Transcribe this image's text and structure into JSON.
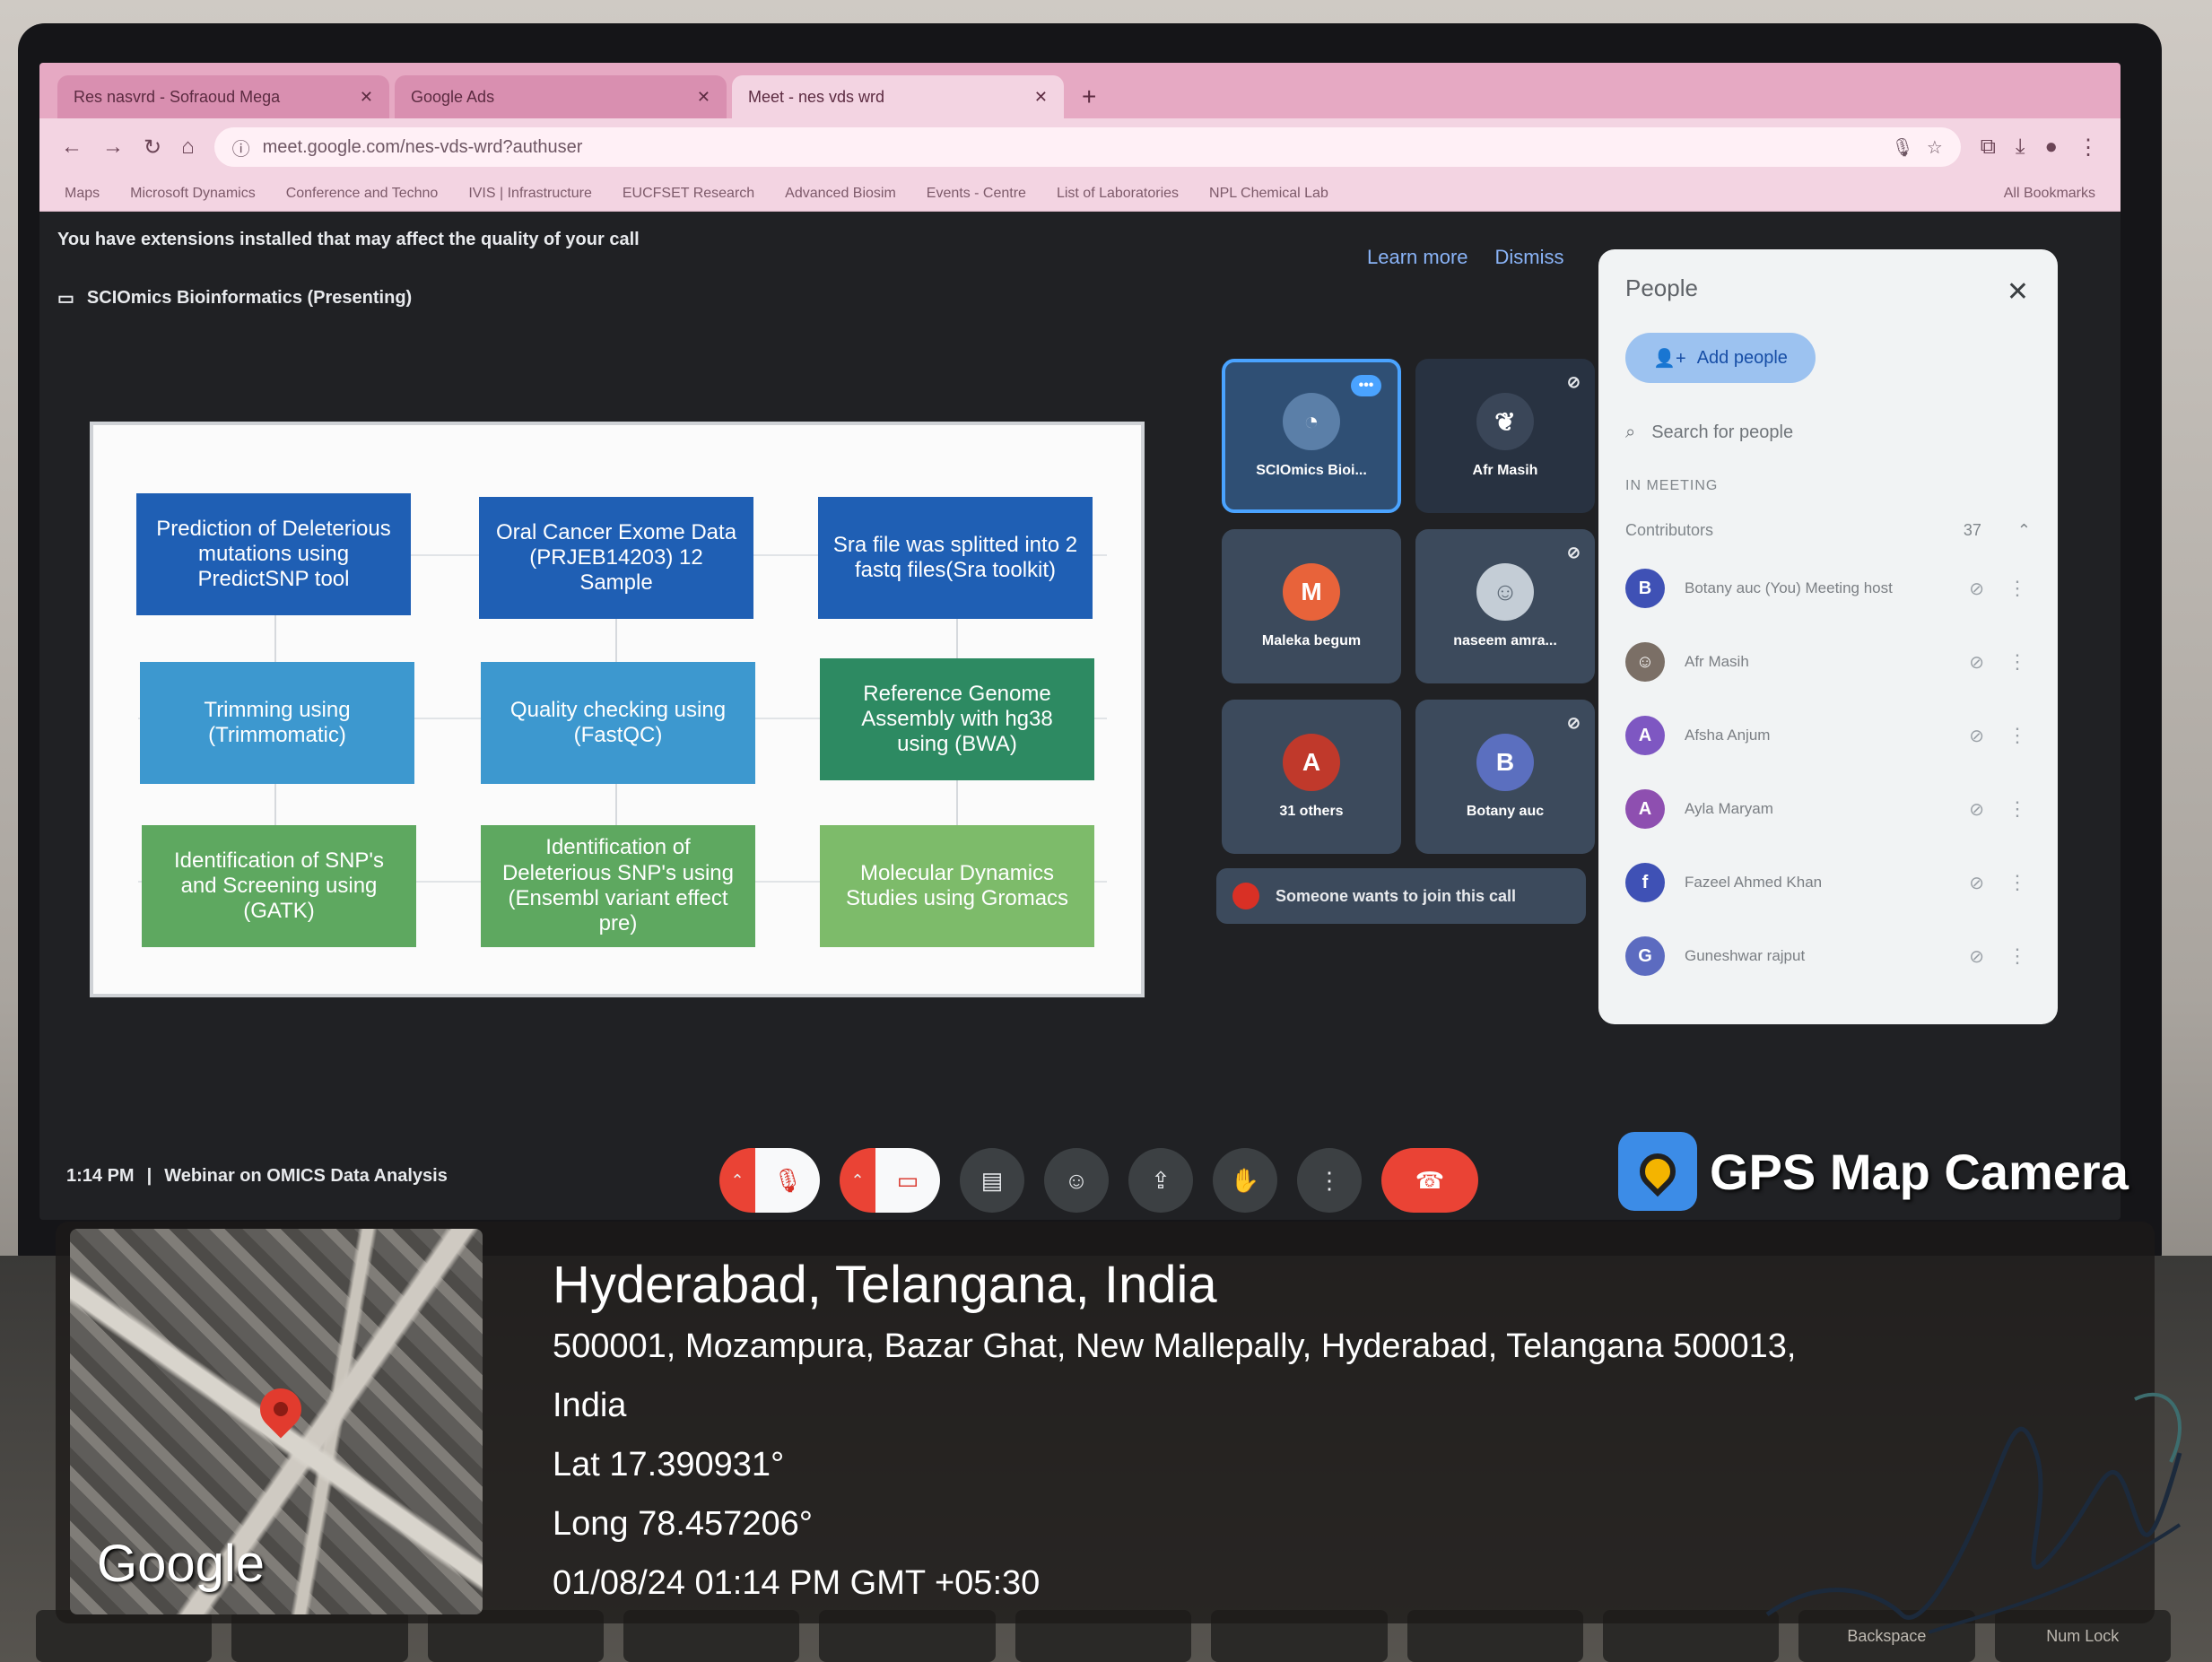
{
  "browser": {
    "tabs": [
      {
        "label": "Res nasvrd - Sofraoud Mega",
        "active": false
      },
      {
        "label": "Google Ads",
        "active": false
      },
      {
        "label": "Meet - nes vds wrd",
        "active": true
      }
    ],
    "address": "meet.google.com/nes-vds-wrd?authuser",
    "bookmarks": [
      "Maps",
      "Microsoft Dynamics",
      "Conference and Techno",
      "IVIS | Infrastructure",
      "EUCFSET Research",
      "Advanced Biosim",
      "Events - Centre",
      "List of Laboratories",
      "NPL Chemical Lab"
    ],
    "all_bookmarks": "All Bookmarks"
  },
  "meet": {
    "extension_banner": "You have extensions installed that may affect the quality of your call",
    "banner_actions": [
      "Learn more",
      "Dismiss"
    ],
    "presenter_label": "SCIOmics Bioinformatics (Presenting)",
    "slide_boxes": [
      {
        "text": "Prediction of Deleterious mutations using PredictSNP tool",
        "style": "dark"
      },
      {
        "text": "Oral Cancer Exome Data (PRJEB14203) 12 Sample",
        "style": "dark"
      },
      {
        "text": "Sra file was splitted into 2 fastq files(Sra toolkit)",
        "style": "dark"
      },
      {
        "text": "Trimming using (Trimmomatic)",
        "style": "sky"
      },
      {
        "text": "Quality checking using (FastQC)",
        "style": "sky"
      },
      {
        "text": "Reference Genome Assembly with hg38 using (BWA)",
        "style": "teal"
      },
      {
        "text": "Identification of SNP's and Screening using (GATK)",
        "style": "green"
      },
      {
        "text": "Identification of Deleterious SNP's using (Ensembl variant effect pre)",
        "style": "green"
      },
      {
        "text": "Molecular Dynamics Studies using Gromacs",
        "style": "light"
      }
    ],
    "tiles": [
      {
        "name": "SCIOmics Bioi...",
        "initial": "",
        "color": "#5b7fa8"
      },
      {
        "name": "Afr Masih",
        "initial": "",
        "color": "#3a4658"
      },
      {
        "name": "Maleka begum",
        "initial": "M",
        "color": "#e8633a"
      },
      {
        "name": "naseem amra...",
        "initial": "",
        "color": "#c4cdd6"
      },
      {
        "name": "31 others",
        "initial": "A",
        "color": "#c0392b"
      },
      {
        "name": "Botany auc",
        "initial": "B",
        "color": "#5b6fbf"
      }
    ],
    "knock_text": "Someone wants to join this call",
    "meeting_time": "1:14 PM",
    "meeting_title": "Webinar on OMICS Data Analysis"
  },
  "people_panel": {
    "title": "People",
    "add_people": "Add people",
    "search_placeholder": "Search for people",
    "section": "IN MEETING",
    "contributors_label": "Contributors",
    "contributors_count": "37",
    "list": [
      {
        "initial": "B",
        "name": "Botany auc (You) Meeting host",
        "color": "#3f51b5"
      },
      {
        "initial": "",
        "name": "Afr Masih",
        "color": "#7b6f66"
      },
      {
        "initial": "A",
        "name": "Afsha Anjum",
        "color": "#7e57c2"
      },
      {
        "initial": "A",
        "name": "Ayla Maryam",
        "color": "#8e4fb0"
      },
      {
        "initial": "f",
        "name": "Fazeel Ahmed Khan",
        "color": "#3f51b5"
      },
      {
        "initial": "G",
        "name": "Guneshwar rajput",
        "color": "#5c6bc0"
      }
    ]
  },
  "gps": {
    "brand": "GPS Map Camera",
    "city": "Hyderabad, Telangana, India",
    "address_line1": "500001, Mozampura, Bazar Ghat, New Mallepally, Hyderabad, Telangana 500013,",
    "address_line2": "India",
    "lat": "Lat 17.390931°",
    "long": "Long 78.457206°",
    "datetime": "01/08/24 01:14 PM GMT +05:30",
    "map_label": "Google"
  },
  "keyboard": {
    "keys": [
      "",
      "",
      "",
      "",
      "",
      "",
      "",
      "",
      "",
      "Backspace",
      "Num Lock"
    ]
  }
}
